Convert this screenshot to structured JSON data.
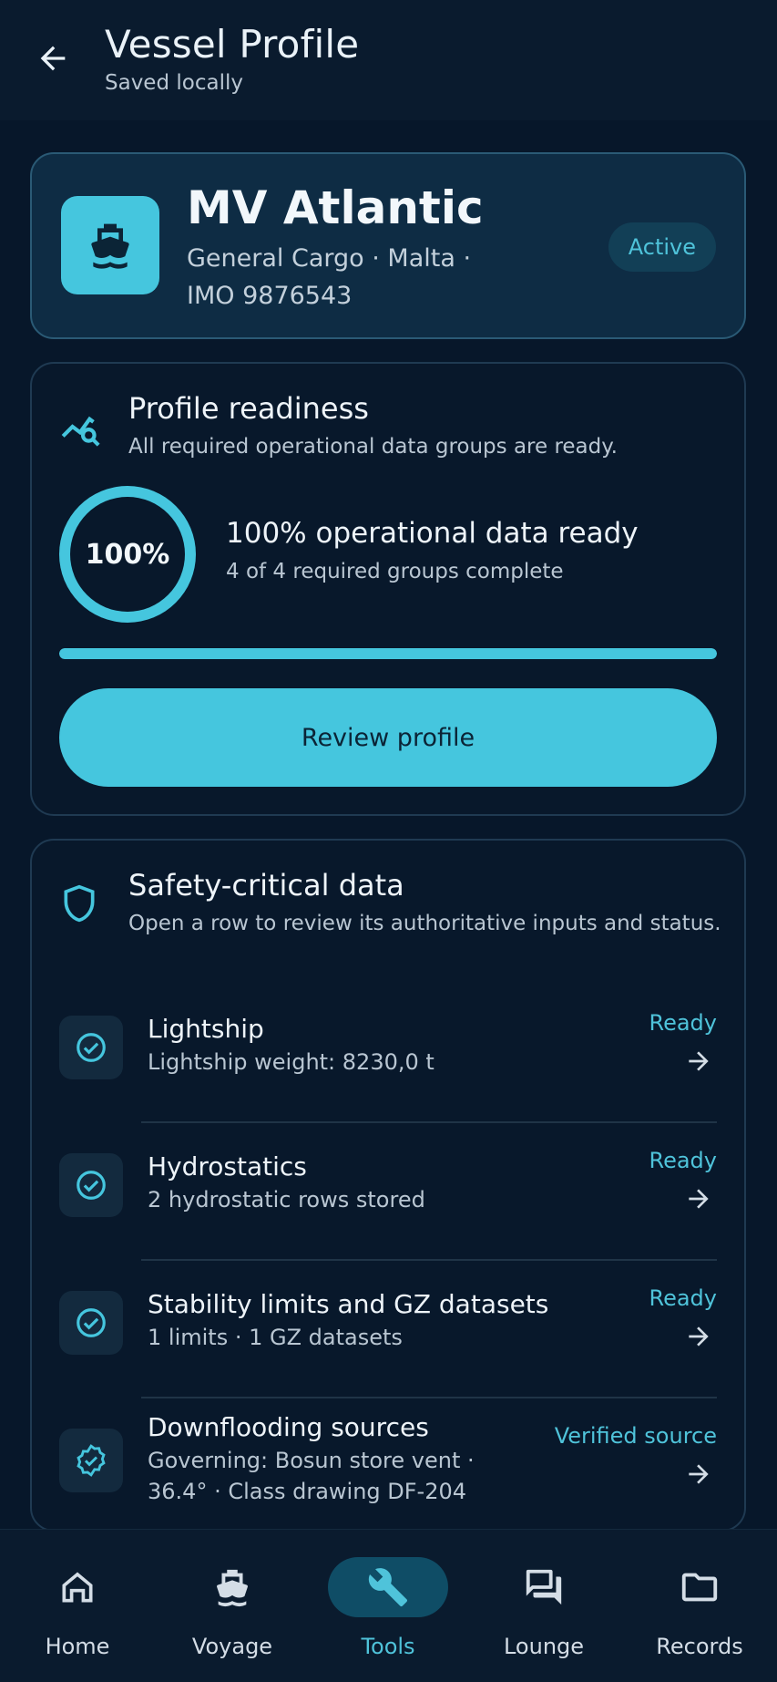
{
  "header": {
    "title": "Vessel Profile",
    "subtitle": "Saved locally"
  },
  "vessel": {
    "name": "MV Atlantic",
    "meta": "General Cargo · Malta · IMO 9876543",
    "status": "Active"
  },
  "readiness": {
    "title": "Profile readiness",
    "description": "All required operational data groups are ready.",
    "percent_label": "100%",
    "percent": 100,
    "headline": "100% operational data ready",
    "subline": "4 of 4 required groups complete",
    "review_label": "Review profile"
  },
  "safety": {
    "title": "Safety-critical data",
    "description": "Open a row to review its authoritative inputs and status.",
    "rows": [
      {
        "title": "Lightship",
        "subtitle": "Lightship weight: 8230,0 t",
        "status": "Ready"
      },
      {
        "title": "Hydrostatics",
        "subtitle": "2 hydrostatic rows stored",
        "status": "Ready"
      },
      {
        "title": "Stability limits and GZ datasets",
        "subtitle": "1 limits · 1 GZ datasets",
        "status": "Ready"
      },
      {
        "title": "Downflooding sources",
        "subtitle": "Governing: Bosun store vent · 36.4° · Class drawing DF-204",
        "status": "Verified source"
      }
    ]
  },
  "nav": {
    "items": [
      {
        "label": "Home",
        "icon": "home-icon"
      },
      {
        "label": "Voyage",
        "icon": "ship-icon"
      },
      {
        "label": "Tools",
        "icon": "wrench-icon",
        "active": true
      },
      {
        "label": "Lounge",
        "icon": "chat-icon"
      },
      {
        "label": "Records",
        "icon": "folder-icon"
      }
    ]
  },
  "colors": {
    "accent": "#45c6de",
    "background": "#07172a",
    "card": "#08182b"
  }
}
